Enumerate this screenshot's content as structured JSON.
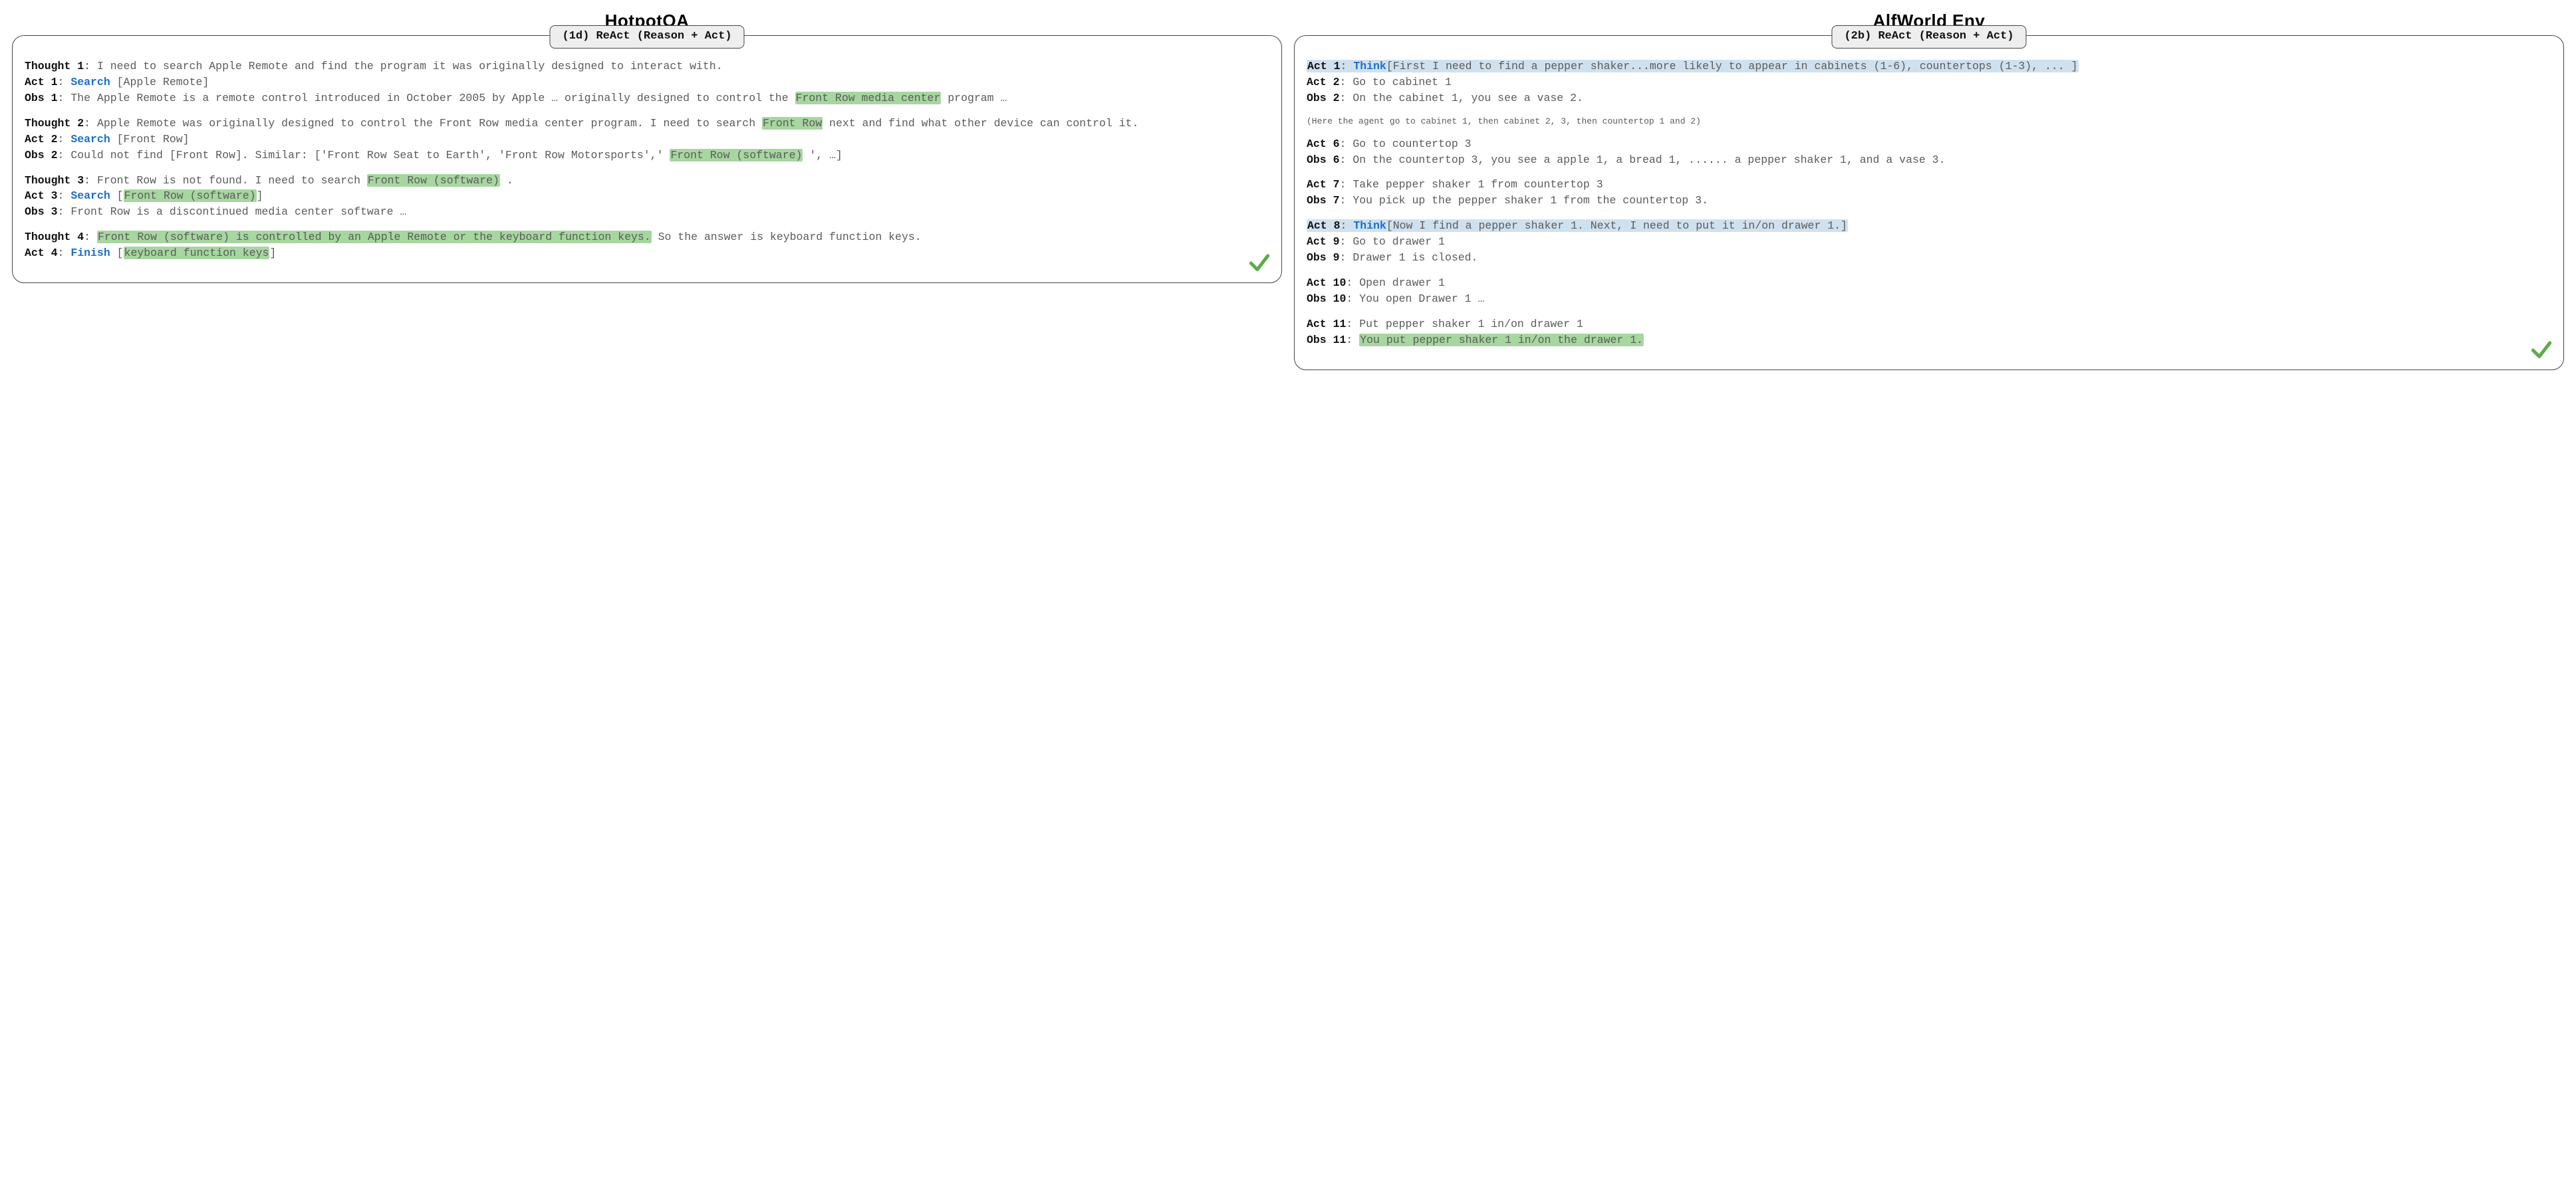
{
  "left": {
    "title": "HotpotQA",
    "tab": "(1d) ReAct (Reason + Act)",
    "labels": {
      "thought1": "Thought 1",
      "act1": "Act 1",
      "obs1": "Obs 1",
      "thought2": "Thought 2",
      "act2": "Act 2",
      "obs2": "Obs 2",
      "thought3": "Thought 3",
      "act3": "Act 3",
      "obs3": "Obs 3",
      "thought4": "Thought 4",
      "act4": "Act 4"
    },
    "thought1": "I need to search Apple Remote and find the program it was originally designed to interact with.",
    "act1_kw": "Search",
    "act1_arg": "[Apple Remote]",
    "obs1_pre": "The Apple Remote is a remote control introduced in October 2005 by Apple … originally designed to control the ",
    "obs1_hl": "Front Row media center",
    "obs1_post": " program …",
    "thought2_pre": "Apple Remote was originally designed to control the Front Row media center program. I need to search  ",
    "thought2_hl": "Front Row",
    "thought2_post": " next and find what other device can control it.",
    "act2_kw": "Search",
    "act2_arg": "[Front Row]",
    "obs2_pre": "Could not find [Front Row]. Similar: ['Front Row Seat to Earth', 'Front Row Motorsports',' ",
    "obs2_hl": "Front Row (software)",
    "obs2_post": "', …]",
    "thought3_pre": "Front Row is not found. I need to search  ",
    "thought3_hl": "Front Row (software)",
    "thought3_post": " .",
    "act3_kw": "Search",
    "act3_open": "[",
    "act3_hl": "Front Row (software)",
    "act3_close": "]",
    "obs3": "Front Row is a discontinued media center software …",
    "thought4_hl": "Front Row (software) is controlled by an Apple Remote or the keyboard function keys.",
    "thought4_post": "  So the answer is keyboard function keys.",
    "act4_kw": "Finish",
    "act4_open": "[",
    "act4_hl": "keyboard function keys",
    "act4_close": "]"
  },
  "right": {
    "title": "AlfWorld Env",
    "tab": "(2b) ReAct (Reason + Act)",
    "labels": {
      "act1": "Act 1",
      "act2": "Act 2",
      "obs2": "Obs 2",
      "act6": "Act 6",
      "obs6": "Obs 6",
      "act7": "Act 7",
      "obs7": "Obs 7",
      "act8": "Act 8",
      "act9": "Act 9",
      "obs9": "Obs 9",
      "act10": "Act 10",
      "obs10": "Obs 10",
      "act11": "Act 11",
      "obs11": "Obs 11"
    },
    "act1_kw": "Think",
    "act1_text": "[First I need to find a pepper shaker...more likely to appear in cabinets (1-6), countertops (1-3), ...   ]",
    "act2": "Go to cabinet 1",
    "obs2": "On the cabinet 1, you see a vase 2.",
    "note": "(Here the agent go to cabinet 1, then cabinet 2, 3, then countertop 1 and 2)",
    "act6": "Go to countertop 3",
    "obs6": "On the countertop 3, you see a apple 1, a bread 1, ...... a pepper shaker 1, and a vase 3.",
    "act7": "Take pepper shaker 1 from countertop 3",
    "obs7": "You pick up the pepper shaker 1 from the countertop 3.",
    "act8_kw": "Think",
    "act8_text": "[Now I find a pepper shaker 1. Next, I need to put it in/on drawer 1.]",
    "act9": "Go to drawer 1",
    "obs9": "Drawer 1 is closed.",
    "act10": "Open drawer 1",
    "obs10": "You open Drawer 1 …",
    "act11": "Put pepper shaker 1 in/on drawer 1",
    "obs11_hl": "You put pepper shaker 1 in/on the drawer 1."
  },
  "icons": {
    "check": "check-icon"
  },
  "colors": {
    "green_highlight": "#a7d6a0",
    "blue_highlight": "#cfe1ef",
    "keyword_blue": "#1d6fc9",
    "check_green": "#5aad47"
  }
}
